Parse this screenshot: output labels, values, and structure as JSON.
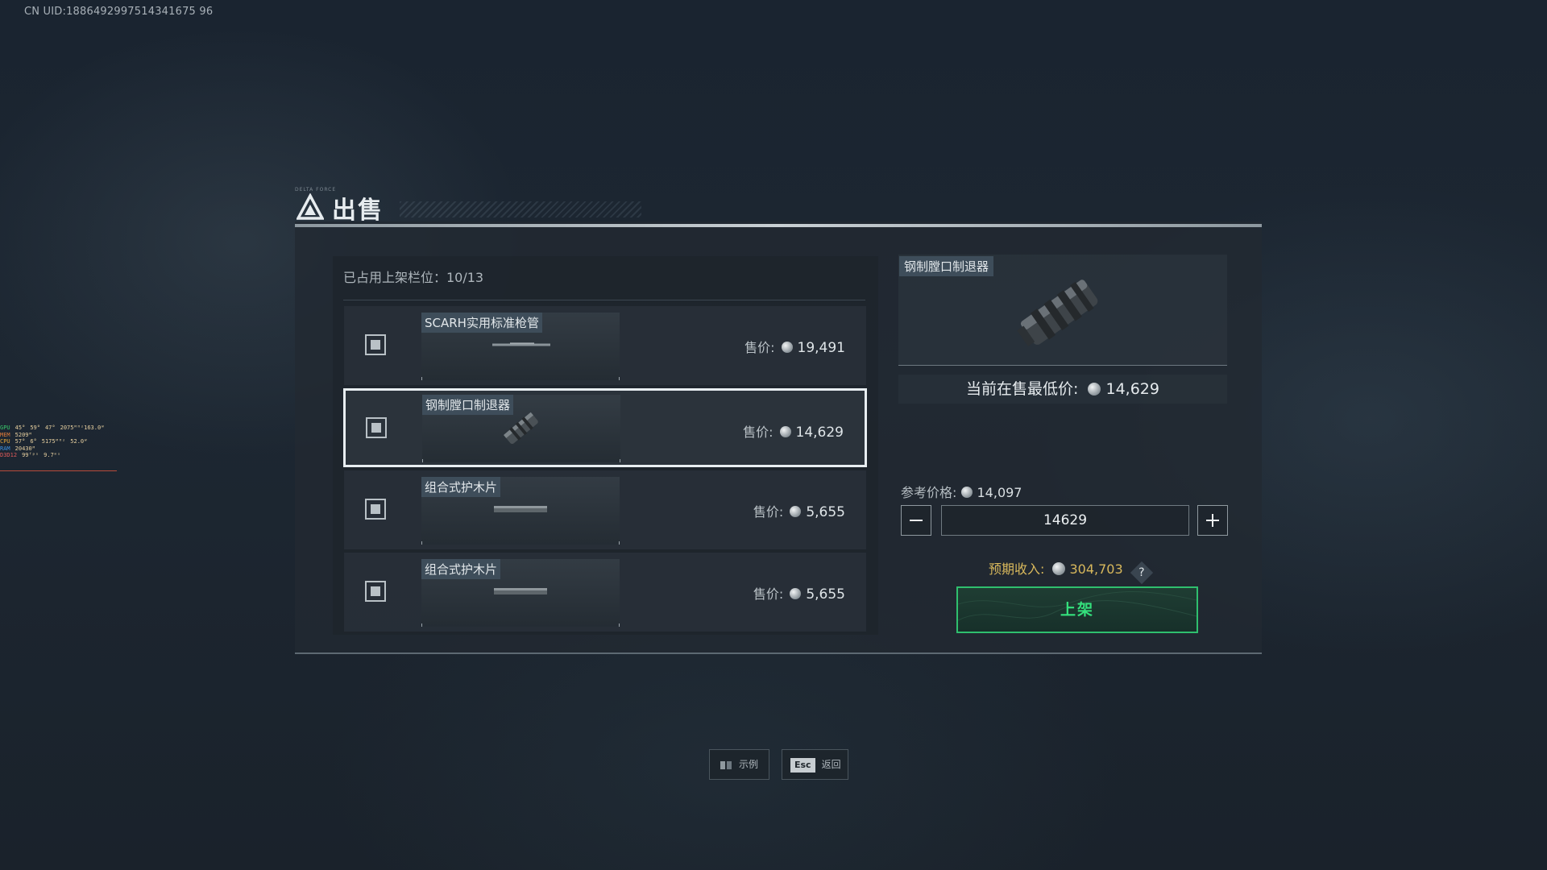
{
  "uid": "CN UID:1886492997514341675 96",
  "overlay": {
    "rows": [
      {
        "label": "GPU",
        "values": [
          "45°",
          "59°",
          "47°",
          "2075ᴹᴴᶻ163.0ᵂ"
        ],
        "color": "#38c46a"
      },
      {
        "label": "MEM",
        "values": [
          "5209ᴹ"
        ],
        "color": "#e07a3a"
      },
      {
        "label": "CPU",
        "values": [
          "57°",
          "6°",
          "5175ᴹᴴᶻ",
          "52.0ᵂ"
        ],
        "color": "#e0a23a"
      },
      {
        "label": "RAM",
        "values": [
          "20430ᴹ"
        ],
        "color": "#3a8ee0"
      },
      {
        "label": "D3D12",
        "values": [
          "99ᶠᵖˢ",
          "9.7ᵐˢ"
        ],
        "color": "#e05a5a"
      }
    ]
  },
  "title": "出售",
  "title_tag": "DELTA FORCE",
  "slots_label": "已占用上架栏位：10/13",
  "items": [
    {
      "name": "SCARH实用标准枪管",
      "price_label": "售价:",
      "price": "19,491",
      "selected": false,
      "art": "barrel"
    },
    {
      "name": "钢制膛口制退器",
      "price_label": "售价:",
      "price": "14,629",
      "selected": true,
      "art": "brake"
    },
    {
      "name": "组合式护木片",
      "price_label": "售价:",
      "price": "5,655",
      "selected": false,
      "art": "rail"
    },
    {
      "name": "组合式护木片",
      "price_label": "售价:",
      "price": "5,655",
      "selected": false,
      "art": "rail"
    }
  ],
  "detail": {
    "name": "钢制膛口制退器",
    "lowest_label": "当前在售最低价:",
    "lowest_value": "14,629",
    "ref_label": "参考价格:",
    "ref_value": "14,097",
    "input_value": "14629",
    "expected_label": "预期收入:",
    "expected_value": "304,703",
    "help": "?",
    "list_button": "上架"
  },
  "hints": [
    {
      "key": "",
      "label": "示例",
      "icon": "book-icon"
    },
    {
      "key": "Esc",
      "label": "返回"
    }
  ],
  "colors": {
    "accent_green": "#34e07c",
    "expected_gold": "#d8b85c",
    "selected_border": "#e8eef1"
  }
}
